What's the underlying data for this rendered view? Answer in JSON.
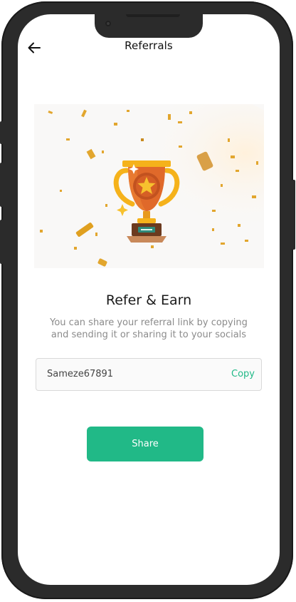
{
  "header": {
    "title": "Referrals",
    "back_icon": "arrow-left-icon"
  },
  "hero": {
    "illustration": "trophy-confetti-illustration"
  },
  "content": {
    "heading": "Refer & Earn",
    "description": "You can share your referral link by copying and sending it or sharing it to your socials"
  },
  "referral": {
    "code": "Sameze67891",
    "copy_label": "Copy"
  },
  "actions": {
    "share_label": "Share"
  },
  "colors": {
    "accent": "#21b987",
    "trophy_gold": "#f5b21b",
    "trophy_orange": "#e0692a",
    "frame": "#2b2b2b"
  }
}
